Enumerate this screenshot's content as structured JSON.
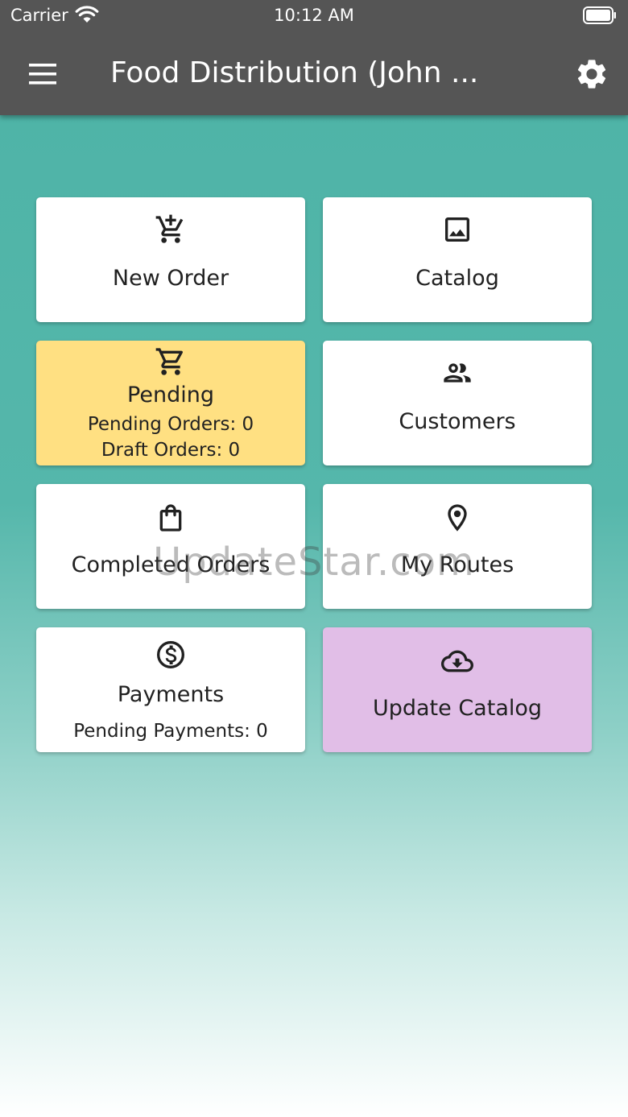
{
  "status_bar": {
    "carrier": "Carrier",
    "time": "10:12 AM"
  },
  "app_bar": {
    "title": "Food Distribution (John ...",
    "menu_icon": "hamburger-menu-icon",
    "settings_icon": "gear-icon"
  },
  "colors": {
    "app_bar": "#555555",
    "background_top": "#4db3a6",
    "background_bottom": "#ffffff",
    "tile_default": "#ffffff",
    "tile_pending": "#ffe082",
    "tile_update_catalog": "#e1bee7"
  },
  "tiles": [
    {
      "label": "New Order",
      "icon": "add-shopping-cart-icon"
    },
    {
      "label": "Catalog",
      "icon": "image-icon"
    },
    {
      "label": "Pending",
      "icon": "shopping-cart-icon",
      "lines": [
        "Pending Orders: 0",
        "Draft Orders: 0"
      ]
    },
    {
      "label": "Customers",
      "icon": "people-icon"
    },
    {
      "label": "Completed Orders",
      "icon": "shopping-bag-icon"
    },
    {
      "label": "My Routes",
      "icon": "location-pin-icon"
    },
    {
      "label": "Payments",
      "icon": "dollar-circle-icon",
      "lines": [
        "Pending Payments: 0"
      ]
    },
    {
      "label": "Update Catalog",
      "icon": "cloud-download-icon"
    }
  ],
  "watermark": "UpdateStar.com"
}
